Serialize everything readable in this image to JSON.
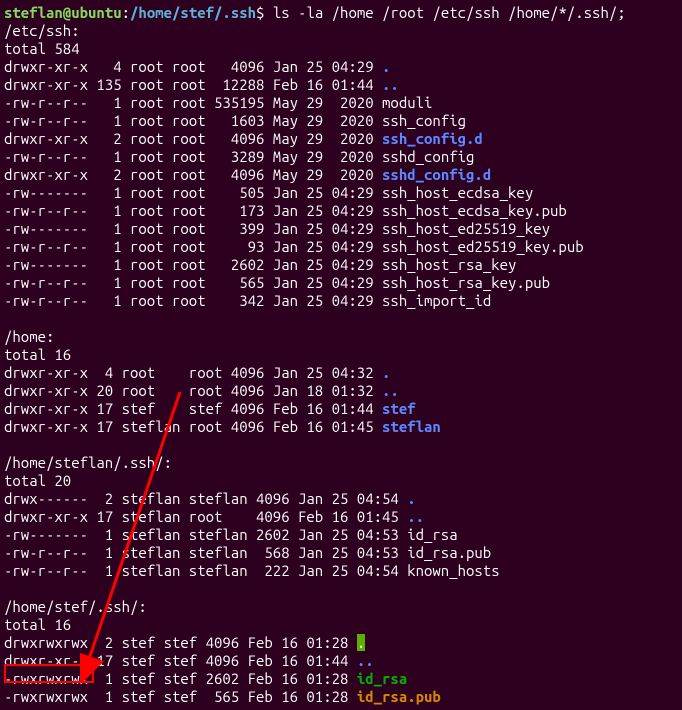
{
  "prompt": {
    "user": "steflan@ubuntu",
    "colon": ":",
    "path": "/home/stef/.ssh",
    "symbol": "$ ",
    "command": "ls -la /home /root /etc/ssh /home/*/.ssh/;"
  },
  "sections": [
    {
      "header": "/etc/ssh:",
      "total": "total 584",
      "rows": [
        {
          "perm": "drwxr-xr-x",
          "links": "  4",
          "user": "root",
          "group": "root",
          "size": "  4096",
          "date": "Jan 25 04:29",
          "name": ".",
          "cls": "blue-bold"
        },
        {
          "perm": "drwxr-xr-x",
          "links": "135",
          "user": "root",
          "group": "root",
          "size": " 12288",
          "date": "Feb 16 01:44",
          "name": "..",
          "cls": "blue-bold"
        },
        {
          "perm": "-rw-r--r--",
          "links": "  1",
          "user": "root",
          "group": "root",
          "size": "535195",
          "date": "May 29  2020",
          "name": "moduli",
          "cls": ""
        },
        {
          "perm": "-rw-r--r--",
          "links": "  1",
          "user": "root",
          "group": "root",
          "size": "  1603",
          "date": "May 29  2020",
          "name": "ssh_config",
          "cls": ""
        },
        {
          "perm": "drwxr-xr-x",
          "links": "  2",
          "user": "root",
          "group": "root",
          "size": "  4096",
          "date": "May 29  2020",
          "name": "ssh_config.d",
          "cls": "blue-bold"
        },
        {
          "perm": "-rw-r--r--",
          "links": "  1",
          "user": "root",
          "group": "root",
          "size": "  3289",
          "date": "May 29  2020",
          "name": "sshd_config",
          "cls": ""
        },
        {
          "perm": "drwxr-xr-x",
          "links": "  2",
          "user": "root",
          "group": "root",
          "size": "  4096",
          "date": "May 29  2020",
          "name": "sshd_config.d",
          "cls": "blue-bold"
        },
        {
          "perm": "-rw-------",
          "links": "  1",
          "user": "root",
          "group": "root",
          "size": "   505",
          "date": "Jan 25 04:29",
          "name": "ssh_host_ecdsa_key",
          "cls": ""
        },
        {
          "perm": "-rw-r--r--",
          "links": "  1",
          "user": "root",
          "group": "root",
          "size": "   173",
          "date": "Jan 25 04:29",
          "name": "ssh_host_ecdsa_key.pub",
          "cls": ""
        },
        {
          "perm": "-rw-------",
          "links": "  1",
          "user": "root",
          "group": "root",
          "size": "   399",
          "date": "Jan 25 04:29",
          "name": "ssh_host_ed25519_key",
          "cls": ""
        },
        {
          "perm": "-rw-r--r--",
          "links": "  1",
          "user": "root",
          "group": "root",
          "size": "    93",
          "date": "Jan 25 04:29",
          "name": "ssh_host_ed25519_key.pub",
          "cls": ""
        },
        {
          "perm": "-rw-------",
          "links": "  1",
          "user": "root",
          "group": "root",
          "size": "  2602",
          "date": "Jan 25 04:29",
          "name": "ssh_host_rsa_key",
          "cls": ""
        },
        {
          "perm": "-rw-r--r--",
          "links": "  1",
          "user": "root",
          "group": "root",
          "size": "   565",
          "date": "Jan 25 04:29",
          "name": "ssh_host_rsa_key.pub",
          "cls": ""
        },
        {
          "perm": "-rw-r--r--",
          "links": "  1",
          "user": "root",
          "group": "root",
          "size": "   342",
          "date": "Jan 25 04:29",
          "name": "ssh_import_id",
          "cls": ""
        }
      ]
    },
    {
      "header": "/home:",
      "total": "total 16",
      "rows": [
        {
          "perm": "drwxr-xr-x",
          "links": " 4",
          "user": "root   ",
          "group": "root",
          "size": "4096",
          "date": "Jan 25 04:32",
          "name": ".",
          "cls": "blue-bold"
        },
        {
          "perm": "drwxr-xr-x",
          "links": "20",
          "user": "root   ",
          "group": "root",
          "size": "4096",
          "date": "Jan 18 01:32",
          "name": "..",
          "cls": "blue-bold"
        },
        {
          "perm": "drwxr-xr-x",
          "links": "17",
          "user": "stef   ",
          "group": "stef",
          "size": "4096",
          "date": "Feb 16 01:44",
          "name": "stef",
          "cls": "blue-bold"
        },
        {
          "perm": "drwxr-xr-x",
          "links": "17",
          "user": "steflan",
          "group": "root",
          "size": "4096",
          "date": "Feb 16 01:45",
          "name": "steflan",
          "cls": "blue-bold"
        }
      ]
    },
    {
      "header": "/home/steflan/.ssh/:",
      "total": "total 20",
      "rows": [
        {
          "perm": "drwx------",
          "links": " 2",
          "user": "steflan",
          "group": "steflan",
          "size": "4096",
          "date": "Jan 25 04:54",
          "name": ".",
          "cls": "blue-bold"
        },
        {
          "perm": "drwxr-xr-x",
          "links": "17",
          "user": "steflan",
          "group": "root   ",
          "size": "4096",
          "date": "Feb 16 01:45",
          "name": "..",
          "cls": "blue-bold"
        },
        {
          "perm": "-rw-------",
          "links": " 1",
          "user": "steflan",
          "group": "steflan",
          "size": "2602",
          "date": "Jan 25 04:53",
          "name": "id_rsa",
          "cls": ""
        },
        {
          "perm": "-rw-r--r--",
          "links": " 1",
          "user": "steflan",
          "group": "steflan",
          "size": " 568",
          "date": "Jan 25 04:53",
          "name": "id_rsa.pub",
          "cls": ""
        },
        {
          "perm": "-rw-r--r--",
          "links": " 1",
          "user": "steflan",
          "group": "steflan",
          "size": " 222",
          "date": "Jan 25 04:54",
          "name": "known_hosts",
          "cls": ""
        }
      ]
    },
    {
      "header": "/home/stef/.ssh/:",
      "total": "total 16",
      "rows": [
        {
          "perm": "drwxrwxrwx",
          "links": " 2",
          "user": "stef",
          "group": "stef",
          "size": "4096",
          "date": "Feb 16 01:28",
          "name": ".",
          "cls": "green-bg"
        },
        {
          "perm": "drwxr-xr-x",
          "links": "17",
          "user": "stef",
          "group": "stef",
          "size": "4096",
          "date": "Feb 16 01:44",
          "name": "..",
          "cls": "blue-bold"
        },
        {
          "perm": "-rwxrwxrwx",
          "links": " 1",
          "user": "stef",
          "group": "stef",
          "size": "2602",
          "date": "Feb 16 01:28",
          "name": "id_rsa",
          "cls": "green-bold"
        },
        {
          "perm": "-rwxrwxrwx",
          "links": " 1",
          "user": "stef",
          "group": "stef",
          "size": " 565",
          "date": "Feb 16 01:28",
          "name": "id_rsa.pub",
          "cls": "orange-bold"
        }
      ]
    }
  ]
}
